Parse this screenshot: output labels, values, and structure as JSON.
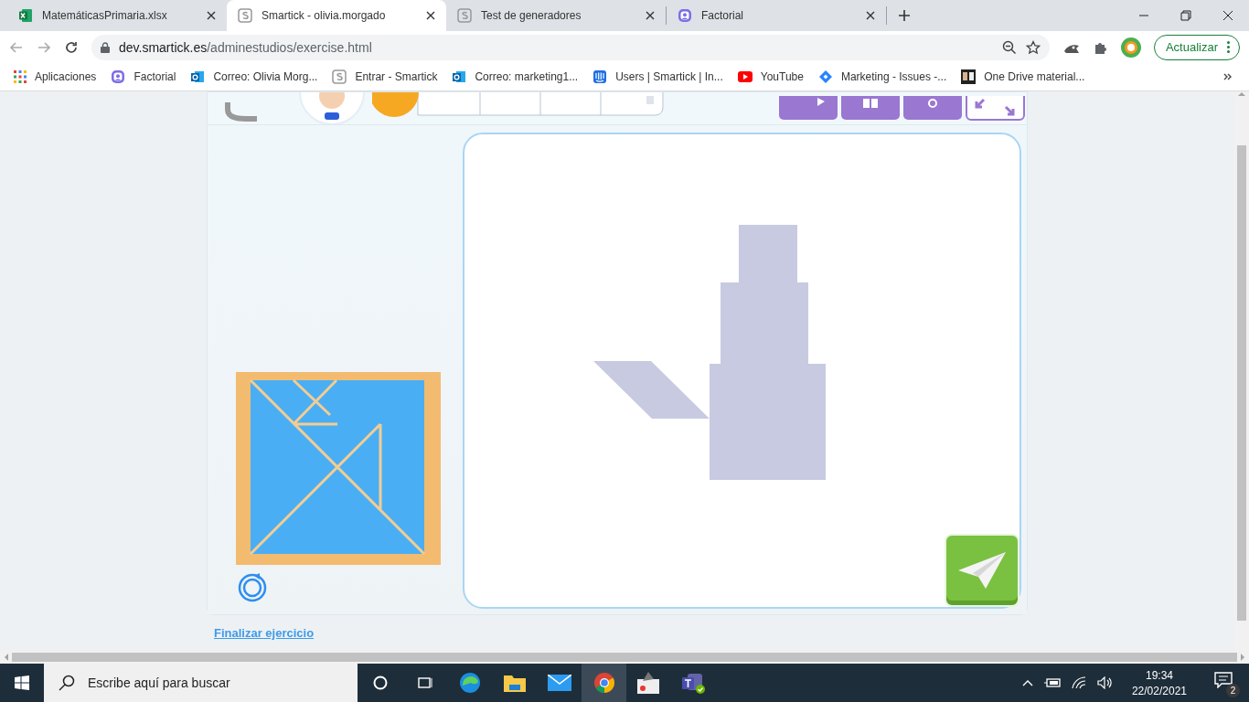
{
  "tabs": [
    {
      "title": "MatemáticasPrimaria.xlsx",
      "kind": "excel",
      "selected": false
    },
    {
      "title": "Smartick - olivia.morgado",
      "kind": "smartick",
      "selected": true
    },
    {
      "title": "Test de generadores",
      "kind": "smartick",
      "selected": false
    },
    {
      "title": "Factorial",
      "kind": "factorial",
      "selected": false
    }
  ],
  "address": {
    "host": "dev.smartick.es",
    "path": "/adminestudios/exercise.html"
  },
  "update_button": "Actualizar",
  "bookmarks": [
    {
      "label": "Aplicaciones",
      "kind": "apps"
    },
    {
      "label": "Factorial",
      "kind": "factorial"
    },
    {
      "label": "Correo: Olivia Morg...",
      "kind": "outlook"
    },
    {
      "label": "Entrar - Smartick",
      "kind": "smartick"
    },
    {
      "label": "Correo: marketing1...",
      "kind": "outlook"
    },
    {
      "label": "Users | Smartick | In...",
      "kind": "intercom"
    },
    {
      "label": "YouTube",
      "kind": "youtube"
    },
    {
      "label": "Marketing - Issues -...",
      "kind": "jira"
    },
    {
      "label": "One Drive material...",
      "kind": "onedrive"
    }
  ],
  "exercise": {
    "finish_link": "Finalizar ejercicio"
  },
  "taskbar": {
    "search_placeholder": "Escribe aquí para buscar",
    "apps": [
      {
        "kind": "cortana",
        "selected": false
      },
      {
        "kind": "taskview",
        "selected": false
      },
      {
        "kind": "edge",
        "selected": false
      },
      {
        "kind": "explorer",
        "selected": false
      },
      {
        "kind": "mail",
        "selected": false
      },
      {
        "kind": "chrome",
        "selected": true
      },
      {
        "kind": "gimp",
        "selected": false
      },
      {
        "kind": "teams",
        "selected": false
      }
    ],
    "time": "19:34",
    "date": "22/02/2021",
    "notifications": "2"
  }
}
